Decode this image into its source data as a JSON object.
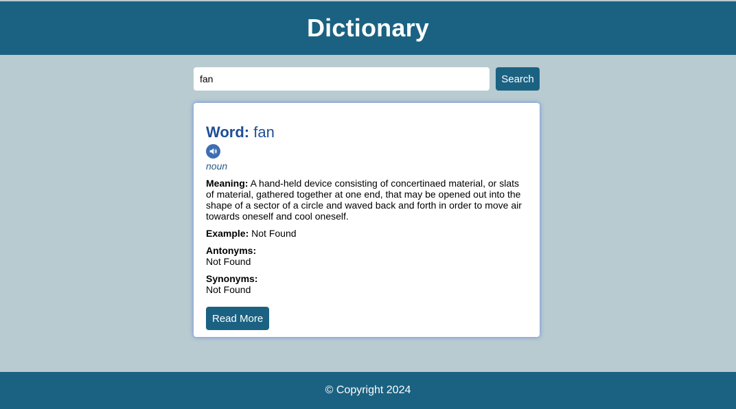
{
  "header": {
    "title": "Dictionary"
  },
  "search": {
    "value": "fan",
    "button_label": "Search"
  },
  "result": {
    "word_label": "Word:",
    "word": "fan",
    "audio_icon": "speaker-icon",
    "part_of_speech": "noun",
    "meaning_label": "Meaning:",
    "meaning": "A hand-held device consisting of concertinaed material, or slats of material, gathered together at one end, that may be opened out into the shape of a sector of a circle and waved back and forth in order to move air towards oneself and cool oneself.",
    "example_label": "Example:",
    "example": "Not Found",
    "antonyms_label": "Antonyms:",
    "antonyms": "Not Found",
    "synonyms_label": "Synonyms:",
    "synonyms": "Not Found",
    "read_more_label": "Read More"
  },
  "footer": {
    "copyright": "© Copyright 2024"
  },
  "colors": {
    "page_background": "#b8cbd1",
    "brand": "#1b6282",
    "word_title": "#1f4e96",
    "audio_button": "#3d6db3"
  }
}
